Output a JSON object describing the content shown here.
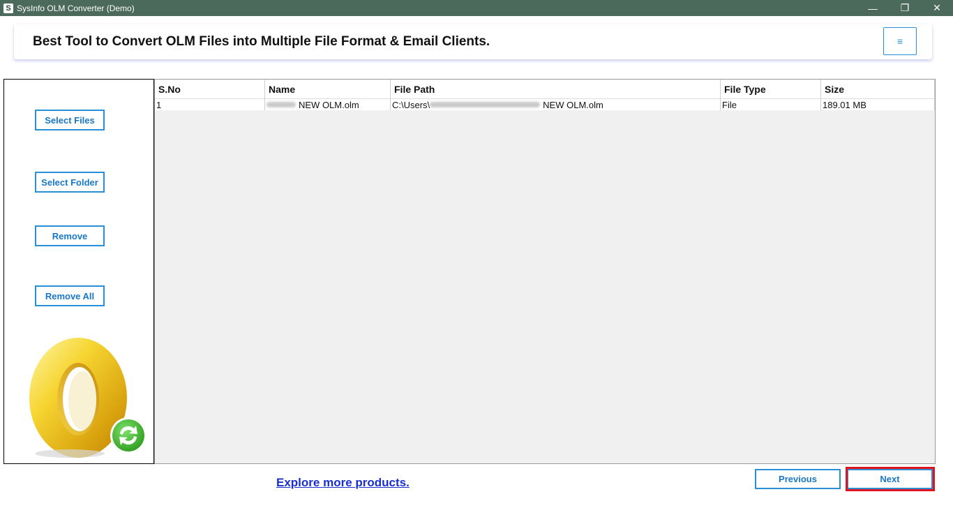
{
  "window": {
    "title": "SysInfo OLM Converter (Demo)",
    "app_icon_letter": "S",
    "minimize_glyph": "—",
    "restore_glyph": "❐",
    "close_glyph": "✕"
  },
  "header": {
    "title": "Best Tool to Convert OLM Files into Multiple File Format & Email Clients.",
    "menu_glyph": "≡"
  },
  "sidebar": {
    "select_files": "Select Files",
    "select_folder": "Select Folder",
    "remove": "Remove",
    "remove_all": "Remove All",
    "logo_icon": "outlook-mac-sync-logo-icon"
  },
  "table": {
    "columns": [
      "S.No",
      "Name",
      "File Path",
      "File Type",
      "Size"
    ],
    "rows": [
      {
        "sno": "1",
        "name": "NEW OLM.olm",
        "path_prefix": "C:\\Users\\",
        "path_suffix": "NEW OLM.olm",
        "type": "File",
        "size": "189.01 MB"
      }
    ]
  },
  "footer": {
    "explore_link": "Explore more products.",
    "previous": "Previous",
    "next": "Next"
  },
  "colors": {
    "titlebar": "#4b6a5c",
    "accent": "#2a8fd6",
    "highlight": "#e0141e",
    "link": "#1a2fd0"
  }
}
